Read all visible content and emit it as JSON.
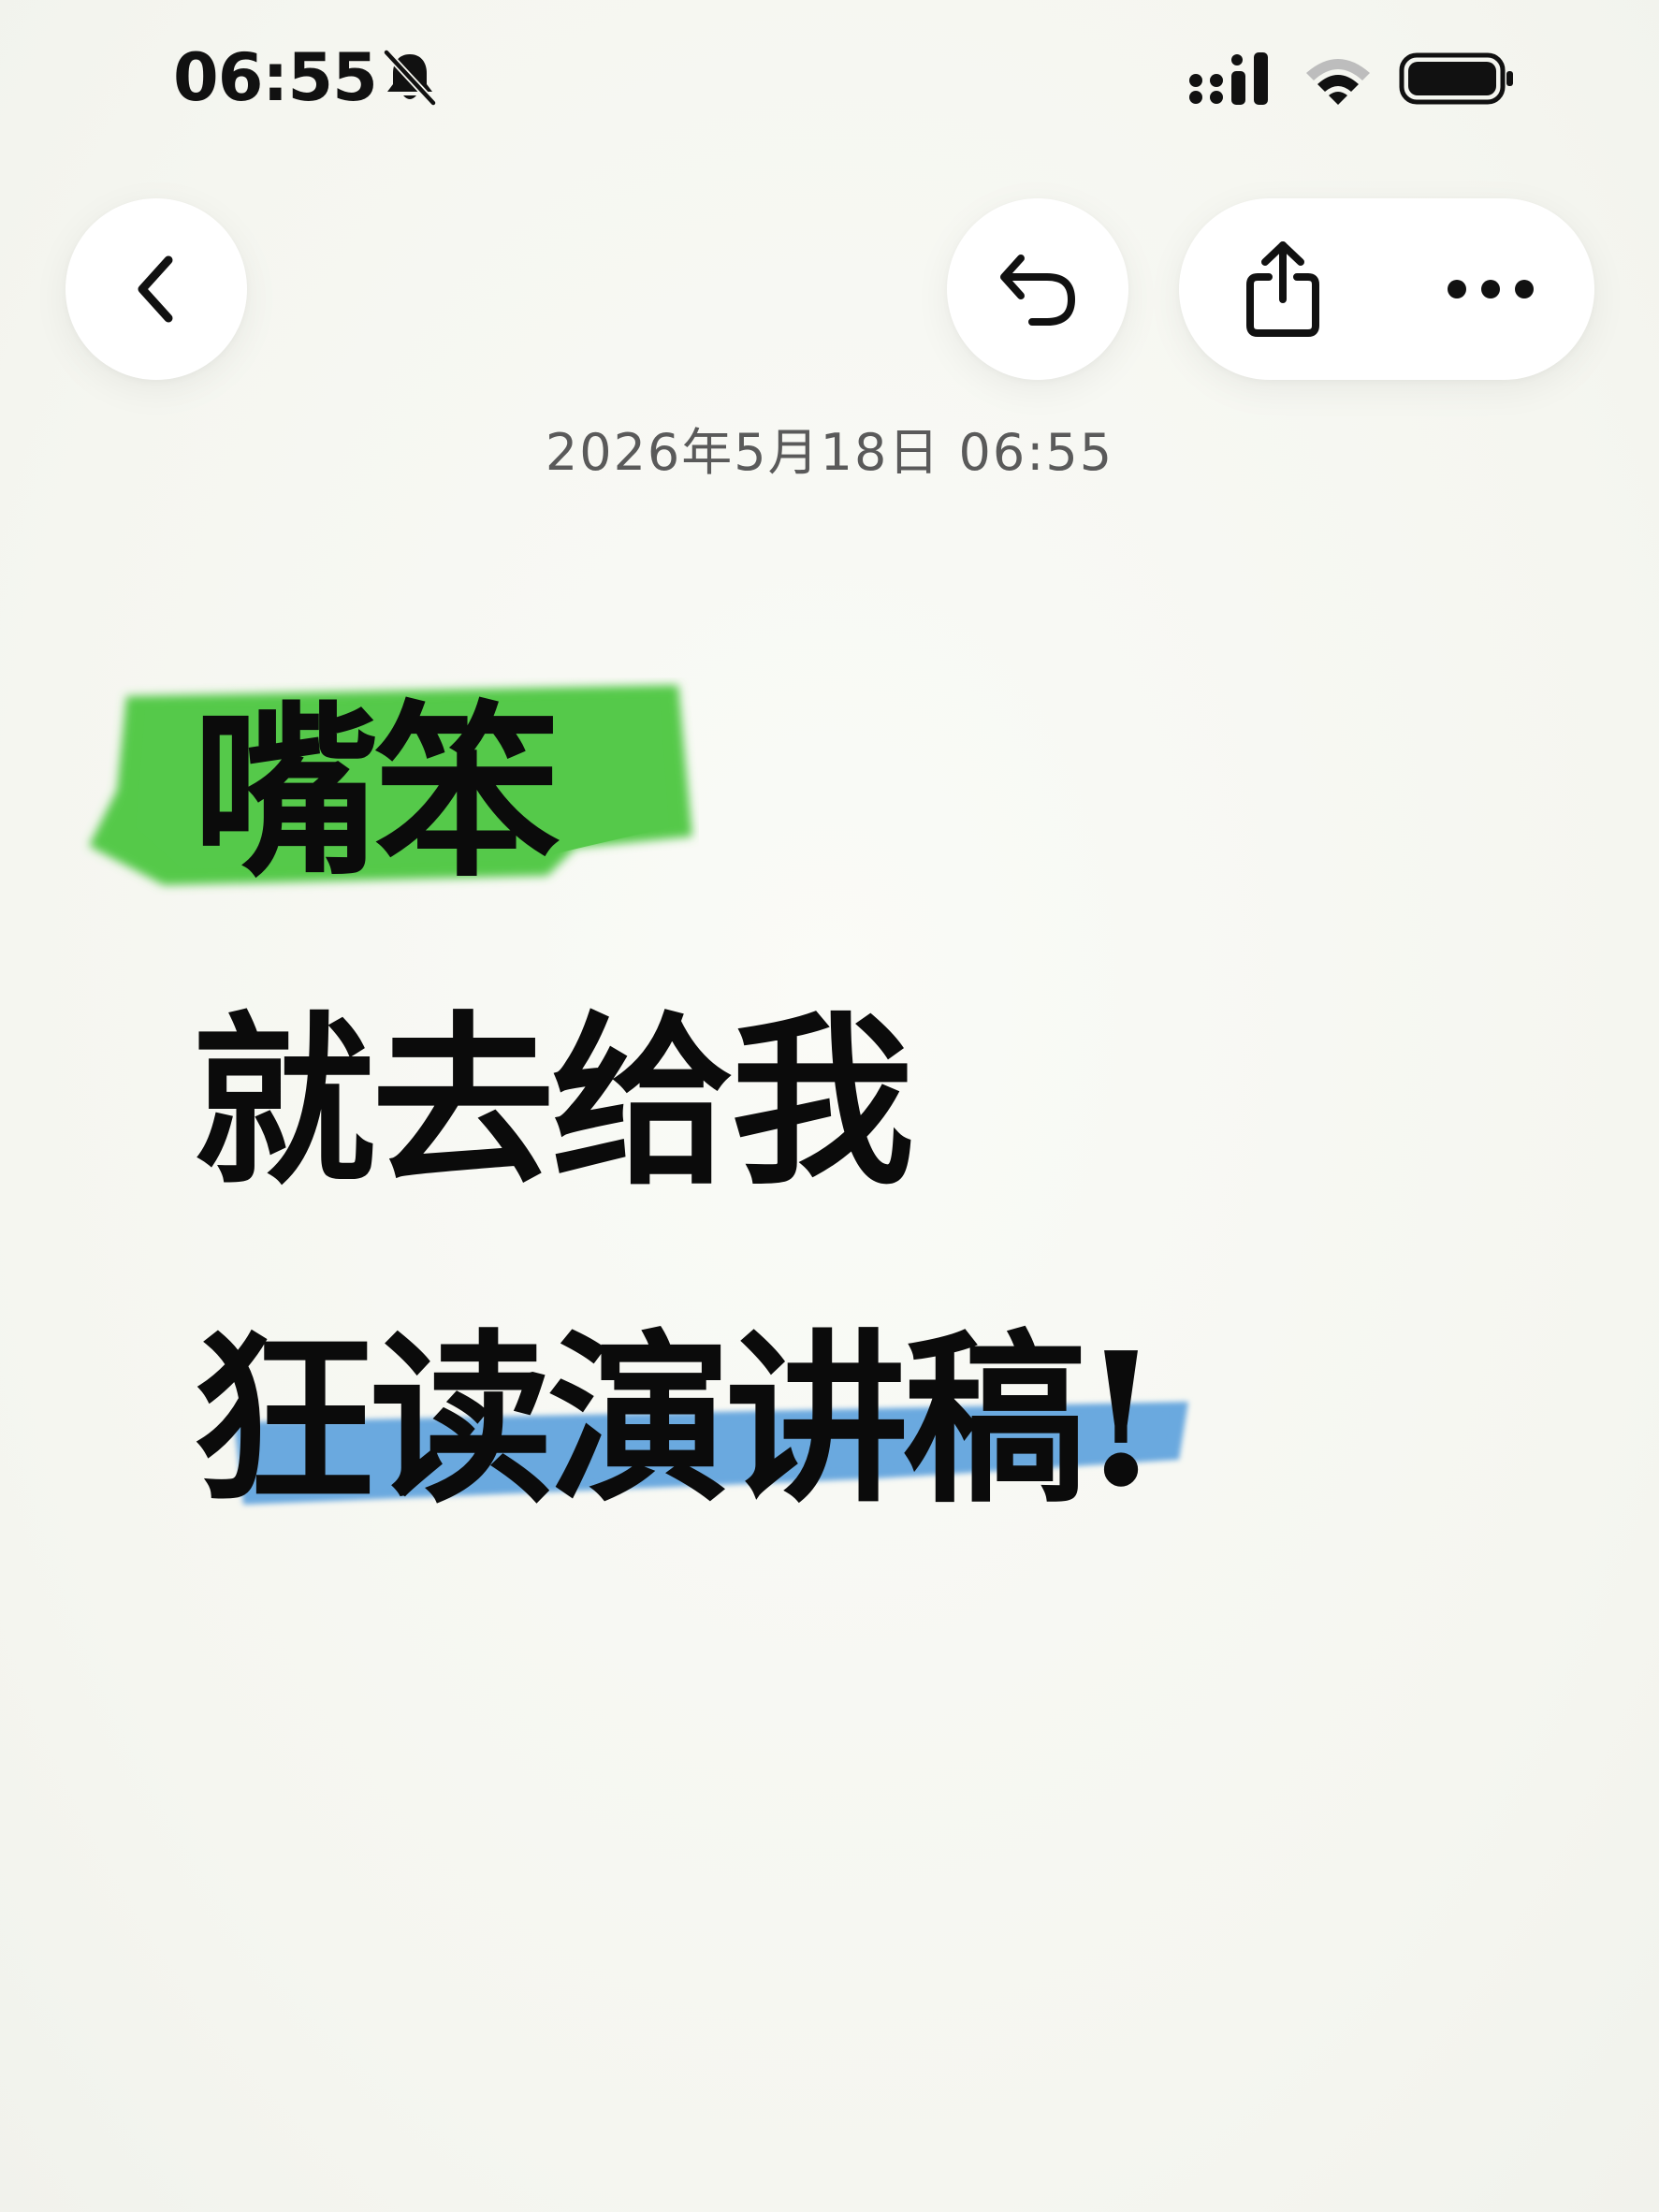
{
  "status_bar": {
    "time": "06:55",
    "icons": [
      "bell-slash-icon",
      "cellular-signal-icon",
      "wifi-icon",
      "battery-icon"
    ]
  },
  "toolbar": {
    "back_icon": "chevron-left-icon",
    "undo_icon": "undo-arrow-icon",
    "share_icon": "share-icon",
    "more_icon": "ellipsis-icon"
  },
  "note": {
    "date": "2026年5月18日 06:55",
    "lines": [
      "嘴笨",
      "就去给我",
      "狂读演讲稿!"
    ],
    "highlight_colors": {
      "green": "#55c94a",
      "blue": "#6aa9df"
    }
  }
}
